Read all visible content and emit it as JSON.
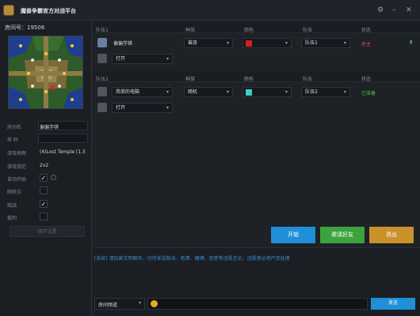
{
  "app": {
    "title": "魔兽争霸官方对战平台"
  },
  "room": {
    "number_label": "房间号：",
    "number": "19506"
  },
  "room_info": {
    "name_label": "房间名",
    "name_value": "偏偏学棋",
    "password_label": "密  码",
    "password_value": "",
    "map_label": "游戏地图",
    "map_value": "(4)Lost Temple [1.5",
    "mode_label": "游戏规范",
    "mode_value": "2v2",
    "autostart_label": "自动开始",
    "autostart_checked": true,
    "random_label": "随机位",
    "random_checked": false,
    "observe_label": "观战",
    "observe_checked": true,
    "referee_label": "裁判",
    "referee_checked": false,
    "save_button": "保存设置"
  },
  "columns": {
    "race": "种族",
    "color": "颜色",
    "team": "队伍",
    "status": "状态"
  },
  "team1": {
    "header": "队伍1",
    "players": [
      {
        "name": "偏偏学棋",
        "race": "兽族",
        "color": "#d0201c",
        "team": "队伍1",
        "status": "房主",
        "status_color": "#e24a56"
      },
      {
        "name": "打开",
        "race": "",
        "color": "",
        "team": "",
        "status": "",
        "status_color": ""
      }
    ]
  },
  "team2": {
    "header": "队伍2",
    "players": [
      {
        "name": "简单的电脑",
        "race": "随机",
        "color": "#3dcfc0",
        "team": "队伍2",
        "status": "已准备",
        "status_color": "#4ec04e"
      },
      {
        "name": "打开",
        "race": "",
        "color": "",
        "team": "",
        "status": "",
        "status_color": ""
      }
    ]
  },
  "actions": {
    "start": "开始",
    "invite": "邀请好友",
    "leave": "退出",
    "start_color": "#1f8fd8",
    "invite_color": "#3ca33c",
    "leave_color": "#c9912a"
  },
  "chat": {
    "system_message": "[系统] 请玩家文明聊天，切勿发送政治、色情、赌博、恶意等违规言论，违规者必将严惩处理",
    "channel": "房间频道",
    "send_button": "发送"
  }
}
